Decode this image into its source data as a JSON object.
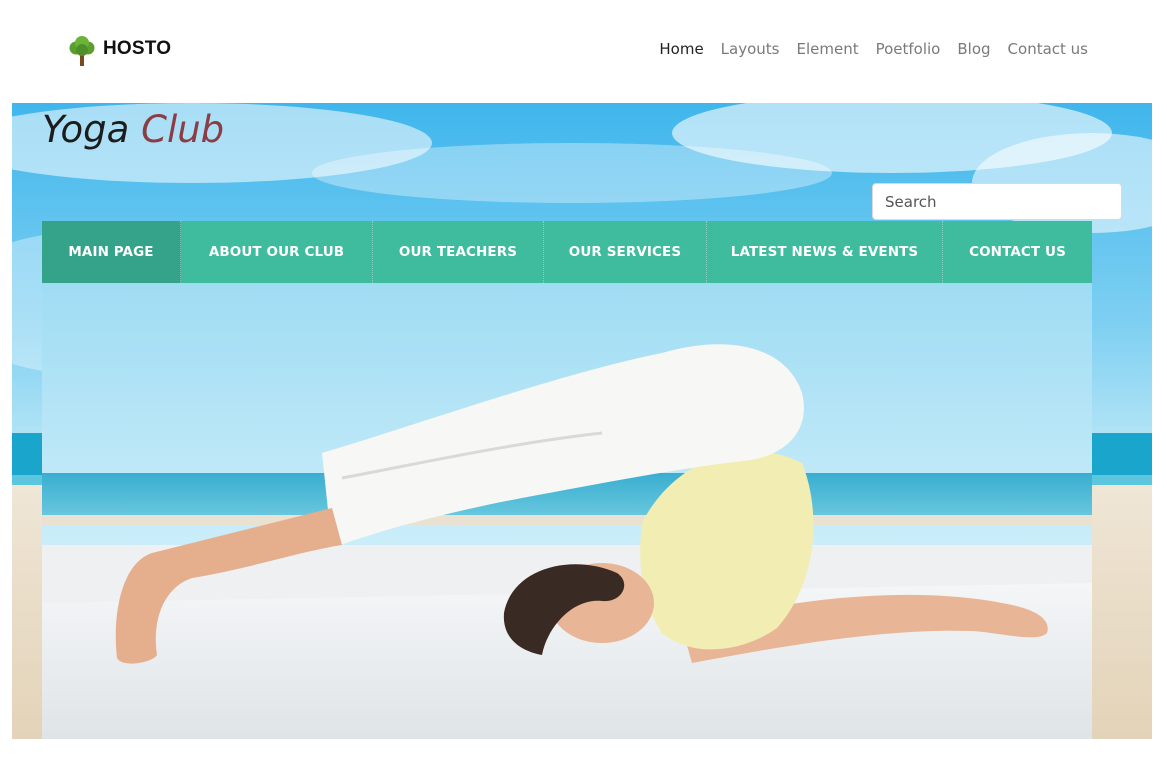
{
  "brand": {
    "name": "HOSTO",
    "logo_icon": "tree-icon"
  },
  "top_nav": {
    "items": [
      {
        "label": "Home",
        "active": true
      },
      {
        "label": "Layouts",
        "active": false
      },
      {
        "label": "Element",
        "active": false
      },
      {
        "label": "Poetfolio",
        "active": false
      },
      {
        "label": "Blog",
        "active": false
      },
      {
        "label": "Contact us",
        "active": false
      }
    ]
  },
  "site": {
    "title_main": "Yoga",
    "title_accent": "Club"
  },
  "search": {
    "placeholder": "Search",
    "value": ""
  },
  "main_nav": {
    "items": [
      {
        "label": "MAIN PAGE",
        "active": true
      },
      {
        "label": "ABOUT OUR CLUB",
        "active": false
      },
      {
        "label": "OUR TEACHERS",
        "active": false
      },
      {
        "label": "OUR SERVICES",
        "active": false
      },
      {
        "label": "LATEST NEWS & EVENTS",
        "active": false
      },
      {
        "label": "CONTACT US",
        "active": false
      }
    ]
  },
  "hero_image": {
    "subject": "woman-yoga-plow-pose-on-beach"
  },
  "colors": {
    "nav_green": "#3fbb9e",
    "nav_active": "#35a38a",
    "title_accent": "#8a3d45",
    "sky": "#5ec6ef"
  }
}
